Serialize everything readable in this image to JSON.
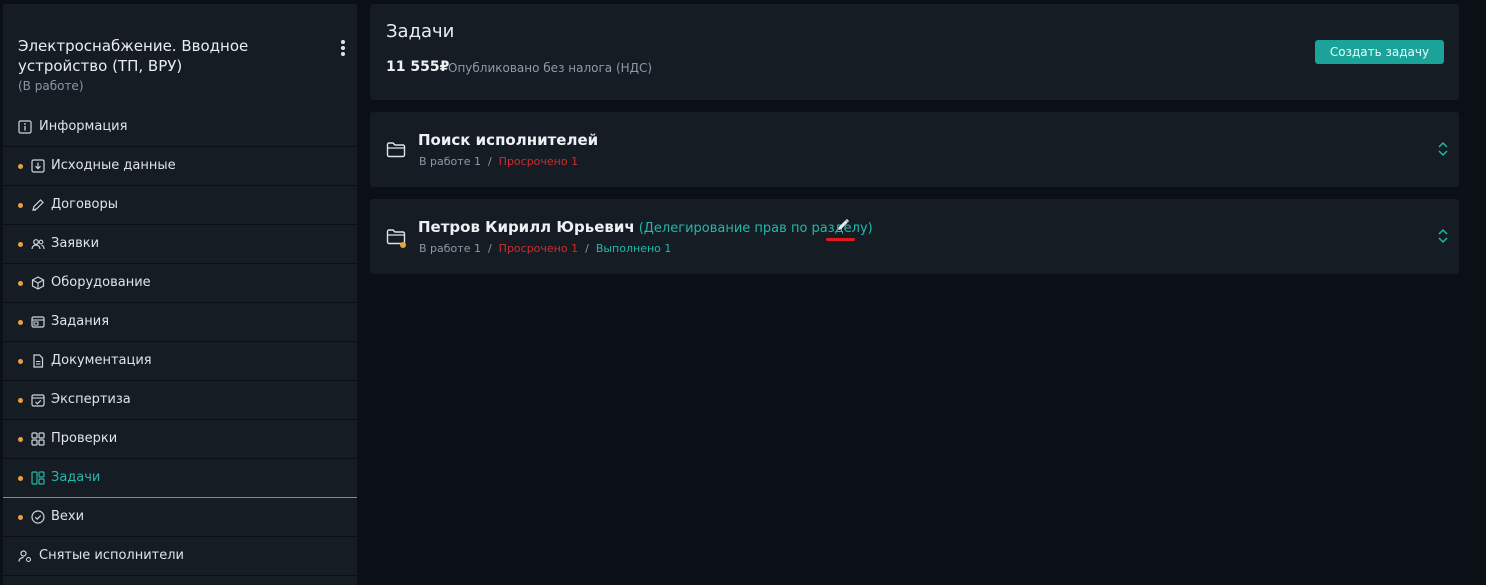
{
  "sidebar": {
    "title": "Электроснабжение. Вводное устройство (ТП, ВРУ)",
    "status": "(В работе)",
    "items": [
      {
        "label": "Информация",
        "icon": "info-icon",
        "dot": false
      },
      {
        "label": "Исходные данные",
        "icon": "download-box-icon",
        "dot": true
      },
      {
        "label": "Договоры",
        "icon": "pen-icon",
        "dot": true
      },
      {
        "label": "Заявки",
        "icon": "users-icon",
        "dot": true
      },
      {
        "label": "Оборудование",
        "icon": "box-icon",
        "dot": true
      },
      {
        "label": "Задания",
        "icon": "window-icon",
        "dot": true
      },
      {
        "label": "Документация",
        "icon": "document-icon",
        "dot": true
      },
      {
        "label": "Экспертиза",
        "icon": "calendar-check-icon",
        "dot": true
      },
      {
        "label": "Проверки",
        "icon": "grid-icon",
        "dot": true
      },
      {
        "label": "Задачи",
        "icon": "board-icon",
        "dot": true,
        "active": true
      },
      {
        "label": "Вехи",
        "icon": "check-circle-icon",
        "dot": true
      },
      {
        "label": "Снятые исполнители",
        "icon": "user-gear-icon",
        "dot": false
      }
    ]
  },
  "header": {
    "title": "Задачи",
    "amount": "11 555₽",
    "note": "Опубликовано без налога (НДС)",
    "create_label": "Создать задачу"
  },
  "groups": [
    {
      "title": "Поиск исполнителей",
      "in_work": "В работе 1",
      "overdue": "Просрочено 1"
    },
    {
      "title": "Петров Кирилл Юрьевич",
      "delegation": "(Делегирование прав по разделу)",
      "in_work": "В работе 1",
      "overdue": "Просрочено 1",
      "done": "Выполнено 1"
    }
  ],
  "colors": {
    "accent": "#22b8ab",
    "warning_dot": "#e9a23b",
    "overdue": "#d12b2b",
    "annotation_red": "#e01a1a",
    "panel": "#151c24",
    "background": "#0b0f16"
  }
}
